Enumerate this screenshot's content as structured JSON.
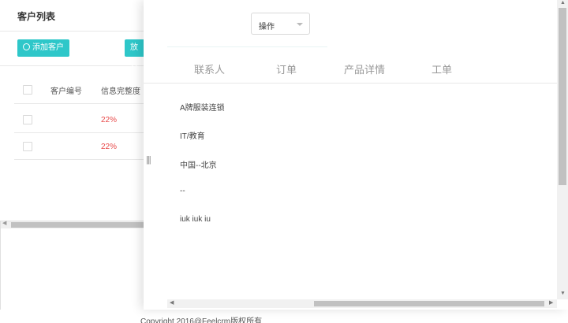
{
  "list": {
    "title": "客户列表",
    "add_button": "添加客户",
    "pool_button": "放入",
    "columns": [
      "客户编号",
      "信息完整度"
    ],
    "rows": [
      {
        "number": "",
        "completeness": "22%"
      },
      {
        "number": "",
        "completeness": "22%"
      }
    ]
  },
  "drawer": {
    "action_select": "操作",
    "drag_handle": "|||",
    "tabs": [
      "联系人",
      "订单",
      "产品详情",
      "工单"
    ],
    "fields": [
      "A牌服装连锁",
      "IT/教育",
      "中国--北京",
      "--",
      "iuk iuk iu"
    ]
  },
  "footer": "Copyright 2016@Feelcrm版权所有",
  "colors": {
    "accent": "#2ec7c9",
    "danger": "#e84a4a"
  },
  "icons": {
    "add_customer": "user-add-icon",
    "select_caret": "caret-down-icon"
  }
}
